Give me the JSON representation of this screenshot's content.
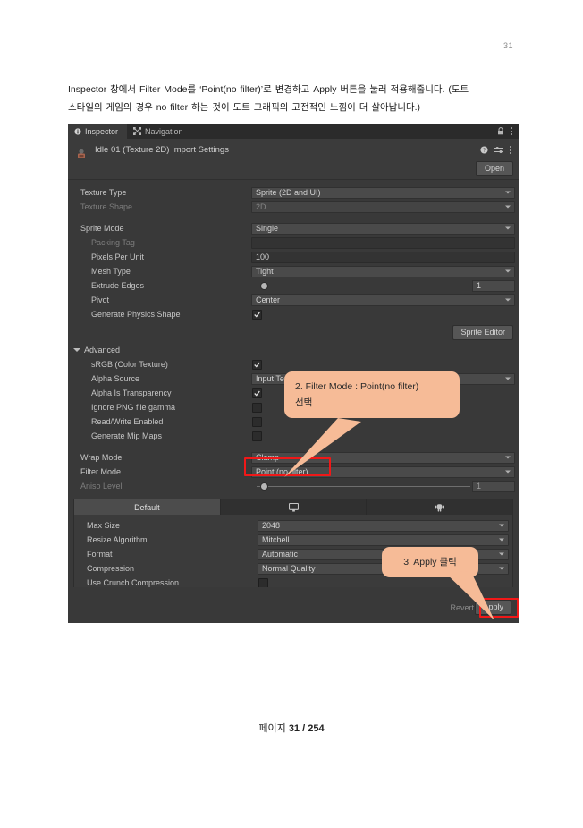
{
  "document": {
    "page_number_top": "31",
    "paragraph_line1": "Inspector 창에서 Filter Mode를 ‘Point(no filter)’로 변경하고 Apply 버튼을 눌러 적용해줍니다. (도트",
    "paragraph_line2": "스타일의 게임의 경우 no filter 하는 것이 도트 그래픽의 고전적인 느낌이 더 살아납니다.)",
    "footer_label": "페이지",
    "footer_current": "31",
    "footer_sep": "/",
    "footer_total": "254"
  },
  "inspector": {
    "tabs": [
      {
        "label": "Inspector",
        "icon": "info-icon",
        "active": true
      },
      {
        "label": "Navigation",
        "icon": "navigation-icon",
        "active": false
      }
    ],
    "title": "Idle 01 (Texture 2D) Import Settings",
    "open_button": "Open",
    "sprite_editor_button": "Sprite Editor",
    "advanced_label": "Advanced",
    "revert_button": "Revert",
    "apply_button": "Apply",
    "rows": [
      {
        "label": "Texture Type",
        "value": "Sprite (2D and UI)",
        "type": "dropdown",
        "dim": false,
        "indent": false
      },
      {
        "label": "Texture Shape",
        "value": "2D",
        "type": "dropdown",
        "dim": true,
        "indent": false
      },
      {
        "label": "Sprite Mode",
        "value": "Single",
        "type": "dropdown",
        "dim": false,
        "indent": false
      },
      {
        "label": "Packing Tag",
        "value": "",
        "type": "text",
        "dim": true,
        "indent": true
      },
      {
        "label": "Pixels Per Unit",
        "value": "100",
        "type": "text",
        "dim": false,
        "indent": true
      },
      {
        "label": "Mesh Type",
        "value": "Tight",
        "type": "dropdown",
        "dim": false,
        "indent": true
      },
      {
        "label": "Extrude Edges",
        "value": "1",
        "type": "slider",
        "dim": false,
        "indent": true,
        "knob_pct": 4
      },
      {
        "label": "Pivot",
        "value": "Center",
        "type": "dropdown",
        "dim": false,
        "indent": true
      },
      {
        "label": "Generate Physics Shape",
        "value": "checked",
        "type": "checkbox",
        "dim": false,
        "indent": true
      }
    ],
    "advanced_rows": [
      {
        "label": "sRGB (Color Texture)",
        "value": "checked",
        "type": "checkbox",
        "dim": false,
        "indent": true
      },
      {
        "label": "Alpha Source",
        "value": "Input Texture Alpha",
        "type": "dropdown",
        "dim": false,
        "indent": true
      },
      {
        "label": "Alpha Is Transparency",
        "value": "checked",
        "type": "checkbox",
        "dim": false,
        "indent": true
      },
      {
        "label": "Ignore PNG file gamma",
        "value": "unchecked",
        "type": "checkbox",
        "dim": false,
        "indent": true
      },
      {
        "label": "Read/Write Enabled",
        "value": "unchecked",
        "type": "checkbox",
        "dim": false,
        "indent": true
      },
      {
        "label": "Generate Mip Maps",
        "value": "unchecked",
        "type": "checkbox",
        "dim": false,
        "indent": true
      }
    ],
    "wrap_rows": [
      {
        "label": "Wrap Mode",
        "value": "Clamp",
        "type": "dropdown",
        "dim": false,
        "indent": false
      },
      {
        "label": "Filter Mode",
        "value": "Point (no filter)",
        "type": "dropdown",
        "dim": false,
        "indent": false
      },
      {
        "label": "Aniso Level",
        "value": "1",
        "type": "slider",
        "dim": true,
        "indent": false,
        "knob_pct": 4
      }
    ],
    "platform_tabs": [
      {
        "label": "Default",
        "icon": "",
        "active": true
      },
      {
        "label": "",
        "icon": "monitor-icon",
        "active": false
      },
      {
        "label": "",
        "icon": "android-icon",
        "active": false
      }
    ],
    "platform_rows": [
      {
        "label": "Max Size",
        "value": "2048",
        "type": "dropdown",
        "dim": false
      },
      {
        "label": "Resize Algorithm",
        "value": "Mitchell",
        "type": "dropdown",
        "dim": false
      },
      {
        "label": "Format",
        "value": "Automatic",
        "type": "dropdown",
        "dim": false
      },
      {
        "label": "Compression",
        "value": "Normal Quality",
        "type": "dropdown",
        "dim": false
      },
      {
        "label": "Use Crunch Compression",
        "value": "unchecked",
        "type": "checkbox",
        "dim": false
      }
    ]
  },
  "annotations": {
    "callout_filter_line1": "2. Filter Mode : Point(no filter)",
    "callout_filter_line2": "선택",
    "callout_apply": "3. Apply 클릭",
    "highlight_color": "#f01818",
    "callout_color": "#f6bb97"
  }
}
